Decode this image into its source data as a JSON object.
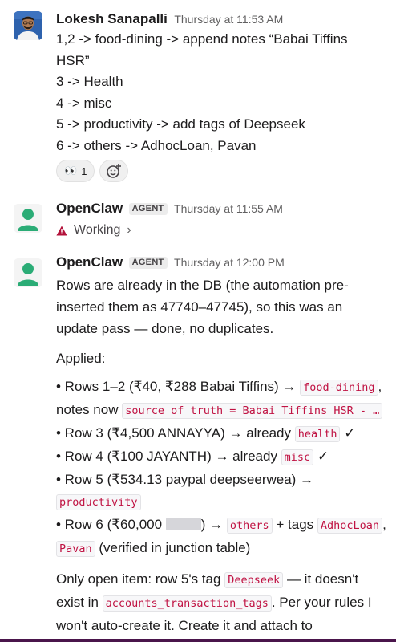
{
  "messages": {
    "m1": {
      "author": "Lokesh Sanapalli",
      "time": "Thursday at 11:53 AM",
      "lines": [
        "1,2 -> food-dining -> append notes “Babai Tiffins",
        "HSR”",
        "3 -> Health",
        "4 -> misc",
        "5 -> productivity -> add tags of Deepseek",
        "6 -> others -> AdhocLoan, Pavan"
      ],
      "reaction": {
        "emoji": "👀",
        "count": "1"
      }
    },
    "m2": {
      "author": "OpenClaw",
      "badge": "AGENT",
      "time": "Thursday at 11:55 AM",
      "status": "Working",
      "status_chevron": "›"
    },
    "m3": {
      "author": "OpenClaw",
      "badge": "AGENT",
      "time": "Thursday at 12:00 PM",
      "intro": "Rows are already in the DB (the automation pre-inserted them as 47740–47745), so this was an update pass — done, no duplicates.",
      "applied": "Applied:",
      "b1_pre": "• Rows 1–2 (₹40, ₹288 Babai Tiffins) → ",
      "b1_code1": "food-dining",
      "b1_mid": ", notes now ",
      "b1_code2": "source of truth = Babai Tiffins HSR - …",
      "b2_pre": "• Row 3 (₹4,500 ANNAYYA) → already ",
      "b2_code": "health",
      "b2_post": " ✓",
      "b3_pre": "• Row 4 (₹100 JAYANTH) → already ",
      "b3_code": "misc",
      "b3_post": " ✓",
      "b4_pre": "• Row 5 (₹534.13 paypal deepseerwea) → ",
      "b4_code": "productivity",
      "b5_pre": "• Row 6 (₹60,000 ",
      "b5_mid": ") → ",
      "b5_code1": "others",
      "b5_mid2": " + tags ",
      "b5_code2": "AdhocLoan",
      "b5_comma": ", ",
      "b5_code3": "Pavan",
      "b5_post": " (verified in junction table)",
      "open_pre": "Only open item: row 5's tag ",
      "open_code1": "Deepseek",
      "open_mid": " — it doesn't exist in ",
      "open_code2": "accounts_transaction_tags",
      "open_post": ". Per your rules I won't auto-create it. Create it and attach to"
    }
  },
  "colors": {
    "code_text": "#c01343",
    "warning_icon": "#b3123a",
    "bot_avatar": "#2bac76",
    "workspace_bar": "#4a154b"
  },
  "icons": {
    "add_reaction": "add-reaction-icon",
    "status": "warning-icon",
    "status_chevron": "chevron-right-icon"
  }
}
